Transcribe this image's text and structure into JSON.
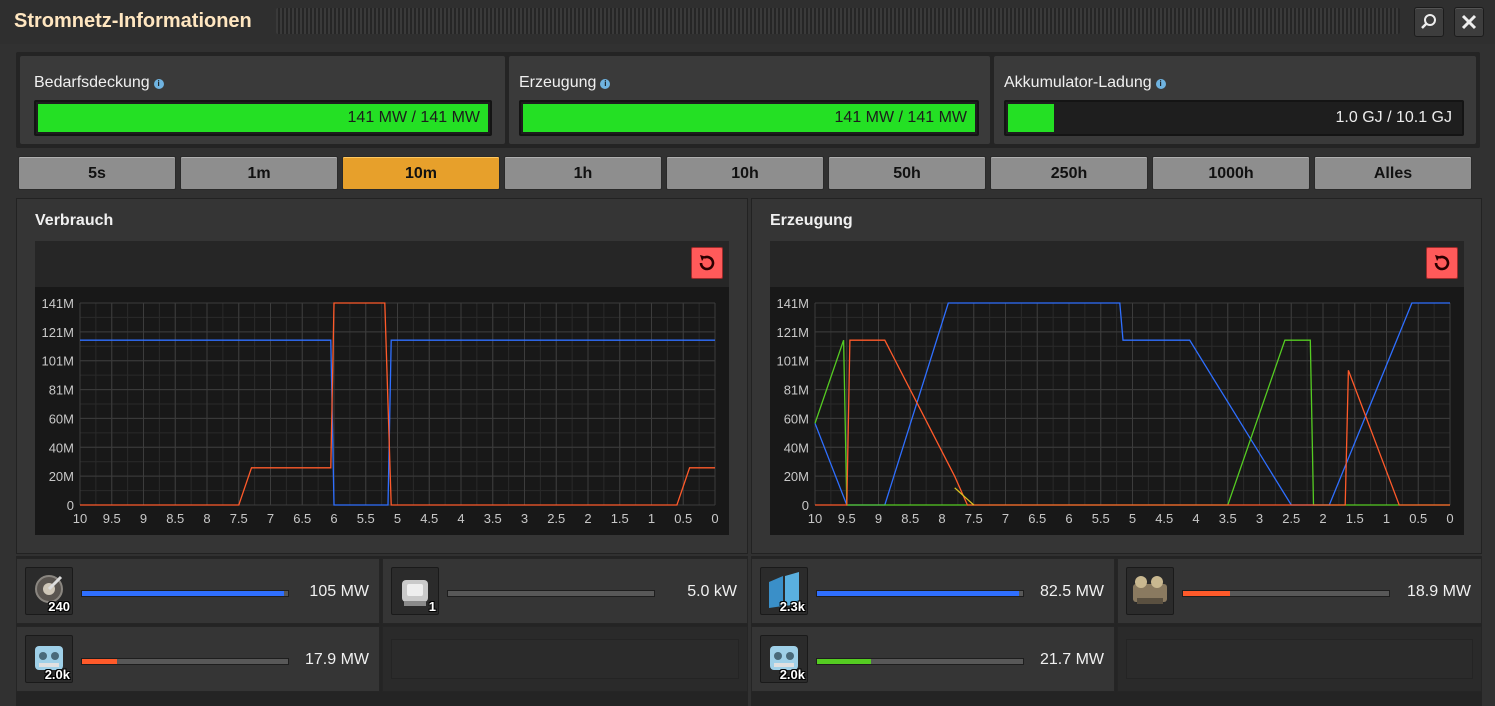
{
  "window": {
    "title": "Stromnetz-Informationen"
  },
  "stats": [
    {
      "label": "Bedarfsdeckung",
      "value": "141 MW / 141 MW",
      "fill": 1.0
    },
    {
      "label": "Erzeugung",
      "value": "141 MW / 141 MW",
      "fill": 1.0
    },
    {
      "label": "Akkumulator-Ladung",
      "value": "1.0 GJ / 10.1 GJ",
      "fill": 0.1
    }
  ],
  "tabs": [
    "5s",
    "1m",
    "10m",
    "1h",
    "10h",
    "50h",
    "250h",
    "1000h",
    "Alles"
  ],
  "active_tab": "10m",
  "colors": {
    "accent": "#e7a02b",
    "bar_green": "#24e024",
    "reset": "#ff5a5a",
    "series_blue": "#2f6fff",
    "series_orange": "#ff5a2a",
    "series_green": "#55cc22",
    "series_yellow": "#d8c020"
  },
  "chart_data": [
    {
      "type": "line",
      "title": "Verbrauch",
      "ylabel": "",
      "xlabel": "",
      "x_ticks": [
        "10",
        "9.5",
        "9",
        "8.5",
        "8",
        "7.5",
        "7",
        "6.5",
        "6",
        "5.5",
        "5",
        "4.5",
        "4",
        "3.5",
        "3",
        "2.5",
        "2",
        "1.5",
        "1",
        "0.5",
        "0"
      ],
      "y_ticks": [
        "0",
        "20M",
        "40M",
        "60M",
        "81M",
        "101M",
        "121M",
        "141M"
      ],
      "xlim": [
        10,
        0
      ],
      "ylim": [
        0,
        141
      ],
      "grid": true,
      "series": [
        {
          "color": "#2f6fff",
          "points": [
            [
              10,
              115
            ],
            [
              6.05,
              115
            ],
            [
              6.0,
              0
            ],
            [
              5.15,
              0
            ],
            [
              5.1,
              115
            ],
            [
              0,
              115
            ]
          ]
        },
        {
          "color": "#ff5a2a",
          "points": [
            [
              10,
              0
            ],
            [
              7.5,
              0
            ],
            [
              7.3,
              26
            ],
            [
              6.05,
              26
            ],
            [
              6.0,
              141
            ],
            [
              5.2,
              141
            ],
            [
              5.1,
              0
            ],
            [
              0.6,
              0
            ],
            [
              0.4,
              26
            ],
            [
              0,
              26
            ]
          ]
        }
      ]
    },
    {
      "type": "line",
      "title": "Erzeugung",
      "ylabel": "",
      "xlabel": "",
      "x_ticks": [
        "10",
        "9.5",
        "9",
        "8.5",
        "8",
        "7.5",
        "7",
        "6.5",
        "6",
        "5.5",
        "5",
        "4.5",
        "4",
        "3.5",
        "3",
        "2.5",
        "2",
        "1.5",
        "1",
        "0.5",
        "0"
      ],
      "y_ticks": [
        "0",
        "20M",
        "40M",
        "60M",
        "81M",
        "101M",
        "121M",
        "141M"
      ],
      "xlim": [
        10,
        0
      ],
      "ylim": [
        0,
        141
      ],
      "grid": true,
      "series": [
        {
          "color": "#2f6fff",
          "points": [
            [
              10,
              57
            ],
            [
              9.5,
              0
            ],
            [
              8.9,
              0
            ],
            [
              7.9,
              141
            ],
            [
              7.7,
              141
            ],
            [
              5.2,
              141
            ],
            [
              5.15,
              115
            ],
            [
              4.1,
              115
            ],
            [
              2.5,
              0
            ],
            [
              1.9,
              0
            ],
            [
              0.6,
              141
            ],
            [
              0,
              141
            ]
          ]
        },
        {
          "color": "#55cc22",
          "points": [
            [
              10,
              57
            ],
            [
              9.55,
              115
            ],
            [
              9.5,
              0
            ],
            [
              3.5,
              0
            ],
            [
              2.6,
              115
            ],
            [
              2.2,
              115
            ],
            [
              2.15,
              0
            ],
            [
              0,
              0
            ]
          ]
        },
        {
          "color": "#ff5a2a",
          "points": [
            [
              10,
              0
            ],
            [
              9.5,
              0
            ],
            [
              9.45,
              115
            ],
            [
              8.9,
              115
            ],
            [
              7.8,
              20
            ],
            [
              7.6,
              0
            ],
            [
              1.65,
              0
            ],
            [
              1.6,
              94
            ],
            [
              0.8,
              0
            ],
            [
              0,
              0
            ]
          ]
        },
        {
          "color": "#d8c020",
          "points": [
            [
              7.8,
              12
            ],
            [
              7.7,
              8
            ],
            [
              7.6,
              4
            ],
            [
              7.5,
              0
            ]
          ]
        }
      ]
    }
  ],
  "consumers": [
    {
      "icon": "laser-turret-icon",
      "count": "240",
      "value": "105 MW",
      "fill": 1.0,
      "color": "#2f6fff"
    },
    {
      "icon": "radar-icon",
      "count": "1",
      "value": "5.0 kW",
      "fill": 0.0,
      "color": "#2f6fff"
    },
    {
      "icon": "accumulator-icon",
      "count": "2.0k",
      "value": "17.9 MW",
      "fill": 0.17,
      "color": "#ff5a2a"
    }
  ],
  "producers": [
    {
      "icon": "solar-panel-icon",
      "count": "2.3k",
      "value": "82.5 MW",
      "fill": 1.0,
      "color": "#2f6fff"
    },
    {
      "icon": "steam-engine-icon",
      "count": "",
      "value": "18.9 MW",
      "fill": 0.23,
      "color": "#ff5a2a"
    },
    {
      "icon": "accumulator-icon",
      "count": "2.0k",
      "value": "21.7 MW",
      "fill": 0.26,
      "color": "#55cc22"
    }
  ]
}
